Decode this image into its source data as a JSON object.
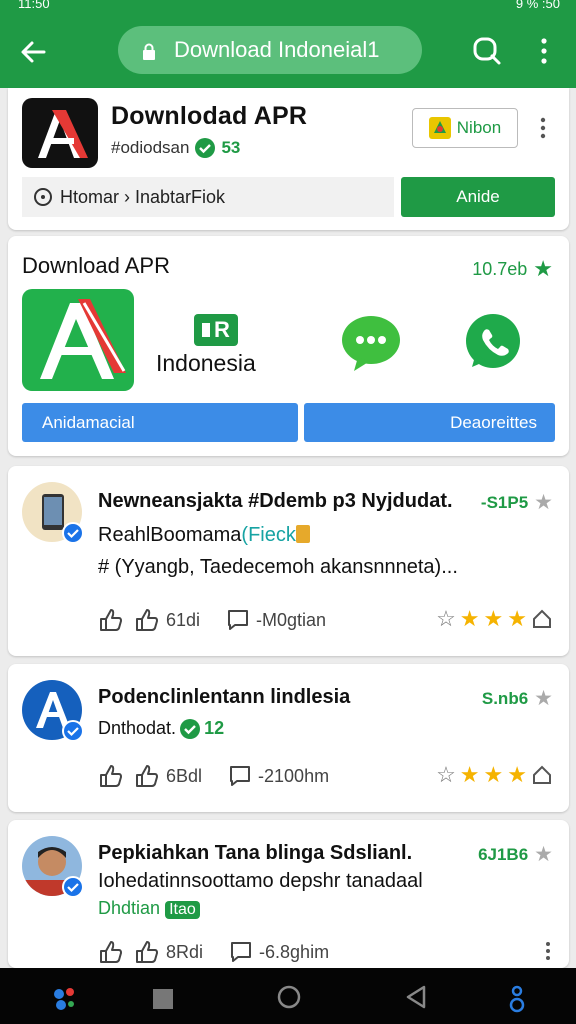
{
  "status_bar": {
    "time": "11:50",
    "battery": "9 %",
    "right_time": ":50"
  },
  "app_bar": {
    "url_text": "Download Indoneial1",
    "icons": [
      "back-arrow-icon",
      "lock-icon",
      "search-icon",
      "more-vert-icon"
    ]
  },
  "app_card": {
    "title": "Downlodad APR",
    "subtitle": "#odiodsan",
    "verified_count": "53",
    "follow_label": "Nibon",
    "breadcrumb": "Htomar › InabtarFiok",
    "action_label": "Anide"
  },
  "feature_card": {
    "title": "Download APR",
    "rating": "10.7eb",
    "badge_text": "R",
    "brand_text": "Indonesia",
    "left_button": "Anidamacial",
    "right_button": "Deaoreittes"
  },
  "posts": [
    {
      "title": "Newneansjakta #Ddemb p3 Nyjdudat.",
      "score": "-S1P5",
      "line1": "ReahlBoomama",
      "line1_highlight": "(Fieck",
      "line2": "# (Yyangb, Taedecemoh akansnnneta)...",
      "action1": "61di",
      "action2": "-M0gtian",
      "rating": 3.5
    },
    {
      "title": "Podenclinlentann lindlesia",
      "score": "S.nb6",
      "line1": "Dnthodat.",
      "line1_badge": "12",
      "action1": "6Bdl",
      "action2": "-2100hm",
      "rating": 3.5
    },
    {
      "title": "Pepkiahkan Tana blinga Sdslianl.",
      "score": "6J1B6",
      "line1": "Iohedatinnsoottamo depshr tanadaal",
      "line2": "Dhdtian",
      "line2_tag": "Itao",
      "action1": "8Rdi",
      "action2": "-6.8ghim"
    }
  ],
  "colors": {
    "brand_green": "#1f9a45",
    "accent_blue": "#3c8ce7",
    "star_gold": "#f5b301"
  }
}
